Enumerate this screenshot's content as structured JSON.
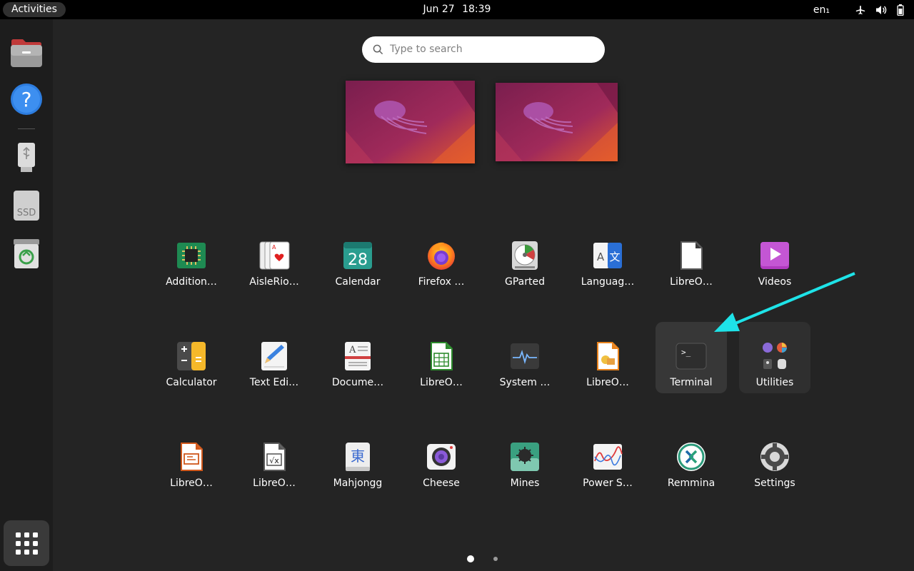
{
  "topbar": {
    "activities_label": "Activities",
    "date": "Jun 27",
    "time": "18:39",
    "language": "en₁",
    "icons": [
      "airplane-mode-icon",
      "volume-icon",
      "battery-icon"
    ]
  },
  "dock": {
    "items": [
      {
        "name": "Files",
        "icon": "files-icon"
      },
      {
        "name": "Help",
        "icon": "help-icon"
      },
      {
        "name": "USB drive",
        "icon": "usb-drive-icon"
      },
      {
        "name": "SSD",
        "icon": "ssd-drive-icon",
        "label": "SSD"
      },
      {
        "name": "Trash",
        "icon": "trash-icon"
      }
    ],
    "show_apps_icon": "app-grid-icon"
  },
  "search": {
    "placeholder": "Type to search"
  },
  "apps": [
    {
      "label": "Addition…",
      "icon": "chip-icon"
    },
    {
      "label": "AisleRio…",
      "icon": "cards-icon"
    },
    {
      "label": "Calendar",
      "icon": "calendar-icon",
      "icon_text": "28"
    },
    {
      "label": "Firefox …",
      "icon": "firefox-icon"
    },
    {
      "label": "GParted",
      "icon": "gparted-icon"
    },
    {
      "label": "Languag…",
      "icon": "language-icon",
      "icon_text": "A 文"
    },
    {
      "label": "LibreO…",
      "icon": "libreoffice-icon"
    },
    {
      "label": "Videos",
      "icon": "videos-icon"
    },
    {
      "label": "Calculator",
      "icon": "calculator-icon"
    },
    {
      "label": "Text Edi…",
      "icon": "text-editor-icon"
    },
    {
      "label": "Docume…",
      "icon": "document-viewer-icon"
    },
    {
      "label": "LibreO…",
      "icon": "libreoffice-calc-icon"
    },
    {
      "label": "System …",
      "icon": "system-monitor-icon"
    },
    {
      "label": "LibreO…",
      "icon": "libreoffice-draw-icon"
    },
    {
      "label": "Terminal",
      "icon": "terminal-icon",
      "icon_text": ">_"
    },
    {
      "label": "Utilities",
      "icon": "utilities-folder-icon"
    },
    {
      "label": "LibreO…",
      "icon": "libreoffice-impress-icon"
    },
    {
      "label": "LibreO…",
      "icon": "libreoffice-math-icon"
    },
    {
      "label": "Mahjongg",
      "icon": "mahjongg-icon",
      "icon_text": "東"
    },
    {
      "label": "Cheese",
      "icon": "cheese-icon"
    },
    {
      "label": "Mines",
      "icon": "mines-icon"
    },
    {
      "label": "Power S…",
      "icon": "power-statistics-icon"
    },
    {
      "label": "Remmina",
      "icon": "remmina-icon"
    },
    {
      "label": "Settings",
      "icon": "settings-icon"
    }
  ],
  "pager": {
    "pages": 2,
    "current": 1
  },
  "colors": {
    "annotation_arrow": "#1ee3e8",
    "accent": "#e95420",
    "panel": "#000000",
    "background": "#242424"
  }
}
